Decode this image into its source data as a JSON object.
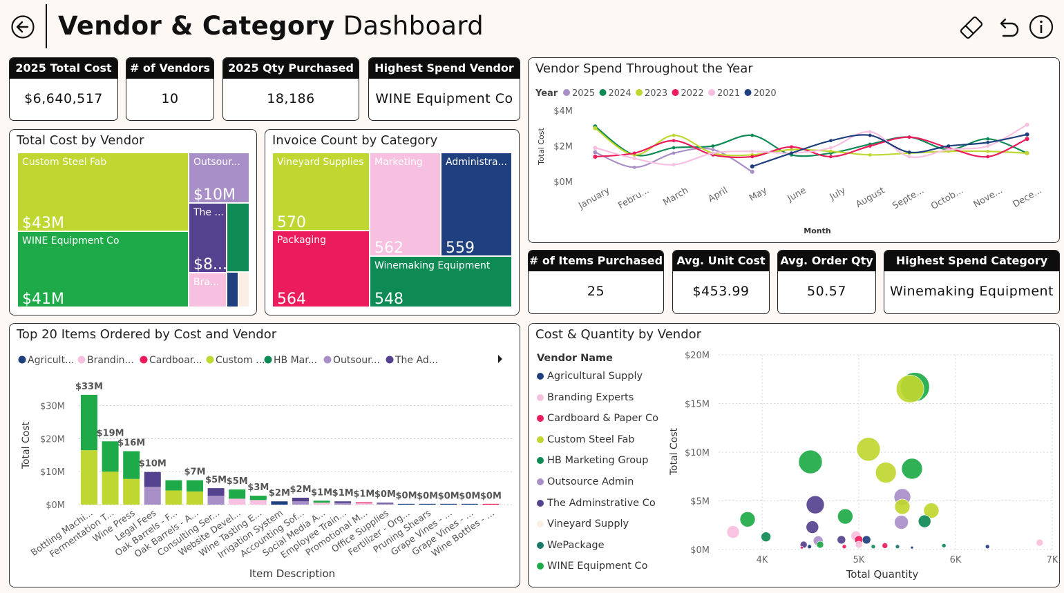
{
  "header": {
    "title_bold": "Vendor & Category",
    "title_rest": "Dashboard"
  },
  "kpis_top": [
    {
      "label": "2025 Total Cost",
      "value": "$6,640,517"
    },
    {
      "label": "# of Vendors",
      "value": "10"
    },
    {
      "label": "2025 Qty Purchased",
      "value": "18,186"
    },
    {
      "label": "Highest Spend Vendor",
      "value": "WINE Equipment Co"
    }
  ],
  "kpis_mid": [
    {
      "label": "# of Items Purchased",
      "value": "25"
    },
    {
      "label": "Avg. Unit Cost",
      "value": "$453.99"
    },
    {
      "label": "Avg. Order Qty",
      "value": "50.57"
    },
    {
      "label": "Highest Spend Category",
      "value": "Winemaking Equipment"
    }
  ],
  "vendor_tree": {
    "title": "Total Cost by Vendor",
    "tiles": [
      {
        "name": "Custom Steel Fab",
        "value": "$43M",
        "color": "#bfd730"
      },
      {
        "name": "WINE Equipment Co",
        "value": "$41M",
        "color": "#1eaa48"
      },
      {
        "name": "Outsour...",
        "value": "$10M",
        "color": "#a98fc8"
      },
      {
        "name": "The ...",
        "value": "$8...",
        "color": "#55428e"
      },
      {
        "name": "Bra...",
        "value": "",
        "color": "#f7bfe0"
      }
    ]
  },
  "category_tree": {
    "title": "Invoice Count by Category",
    "tiles": [
      {
        "name": "Vineyard Supplies",
        "value": "570",
        "color": "#bfd730"
      },
      {
        "name": "Packaging",
        "value": "564",
        "color": "#ec1b5b"
      },
      {
        "name": "Marketing",
        "value": "562",
        "color": "#f7bfe0"
      },
      {
        "name": "Administra...",
        "value": "559",
        "color": "#1f3f7e"
      },
      {
        "name": "Winemaking Equipment",
        "value": "548",
        "color": "#0e8a55"
      }
    ]
  },
  "kpi_colors": {
    "header_bg": "#0d0d0d"
  },
  "chart_data": [
    {
      "type": "line",
      "title": "Vendor Spend Throughout the Year",
      "xlabel": "Month",
      "ylabel": "Total Cost",
      "legend_title": "Year",
      "legend_position": "top-left",
      "categories": [
        "January",
        "Febru...",
        "March",
        "April",
        "May",
        "June",
        "July",
        "August",
        "Septe...",
        "Octob...",
        "Nove...",
        "Dece..."
      ],
      "yticks": [
        "$0M",
        "$2M",
        "$4M"
      ],
      "ylim": [
        0,
        4
      ],
      "series": [
        {
          "name": "2025",
          "color": "#a98fc8",
          "values": [
            1.65,
            0.8,
            1.6,
            1.8,
            0.55,
            null,
            null,
            null,
            null,
            null,
            null,
            null
          ]
        },
        {
          "name": "2024",
          "color": "#0e8a55",
          "values": [
            3.1,
            1.5,
            1.9,
            2.0,
            2.6,
            1.5,
            1.6,
            2.1,
            2.5,
            1.8,
            2.4,
            1.6
          ]
        },
        {
          "name": "2023",
          "color": "#bfd730",
          "values": [
            3.0,
            1.5,
            2.6,
            1.6,
            1.5,
            1.8,
            1.7,
            1.5,
            1.6,
            1.7,
            1.7,
            1.6
          ]
        },
        {
          "name": "2022",
          "color": "#ec1b5b",
          "values": [
            1.4,
            1.6,
            2.3,
            1.5,
            1.4,
            1.95,
            1.4,
            2.0,
            2.5,
            1.9,
            1.4,
            2.4
          ]
        },
        {
          "name": "2021",
          "color": "#f7bfe0",
          "values": [
            1.9,
            1.3,
            0.95,
            1.6,
            1.7,
            1.6,
            1.9,
            2.8,
            1.4,
            1.8,
            2.0,
            3.2
          ]
        },
        {
          "name": "2020",
          "color": "#1f3f7e",
          "values": [
            null,
            null,
            null,
            null,
            0.85,
            1.6,
            2.3,
            2.6,
            1.65,
            2.0,
            2.2,
            2.65
          ]
        }
      ]
    },
    {
      "type": "bar",
      "title": "Top 20 Items Ordered by Cost and Vendor",
      "xlabel": "Item Description",
      "ylabel": "Total Cost",
      "legend_position": "top",
      "legend": [
        {
          "name": "Agricult...",
          "color": "#1f3f7e"
        },
        {
          "name": "Brandin...",
          "color": "#f7bfe0"
        },
        {
          "name": "Cardboar...",
          "color": "#ec1b5b"
        },
        {
          "name": "Custom ...",
          "color": "#bfd730"
        },
        {
          "name": "HB Mar...",
          "color": "#0e8a55"
        },
        {
          "name": "Outsour...",
          "color": "#a98fc8"
        },
        {
          "name": "The Ad...",
          "color": "#55428e"
        }
      ],
      "yticks": [
        "$0M",
        "$10M",
        "$20M",
        "$30M"
      ],
      "ylim": [
        0,
        36
      ],
      "categories": [
        "Bottling Machi...",
        "Fermentation T...",
        "Wine Press",
        "Legal Fees",
        "Oak Barrels - F...",
        "Oak Barrels - A...",
        "Consulting Ser...",
        "Website Devel...",
        "Wine Tasting E...",
        "Irrigation System",
        "Accounting Sof...",
        "Social Media A...",
        "Employee Train...",
        "Promotional M...",
        "Office Supplies",
        "Fertilizer - Org...",
        "Pruning Shears",
        "Grape Vines - ...",
        "Grape Vines - ...",
        "Wine Bottles - ..."
      ],
      "totals_labels": [
        "$33M",
        "$19M",
        "$16M",
        "$10M",
        "",
        "$7M",
        "$5M",
        "$5M",
        "$3M",
        "$2M",
        "$2M",
        "$1M",
        "$1M",
        "$1M",
        "$0M",
        "$0M",
        "$0M",
        "$0M",
        "$0M",
        "$0M"
      ],
      "stacks": [
        [
          {
            "c": "#bfd730",
            "v": 16.5
          },
          {
            "c": "#1eaa48",
            "v": 16.8
          }
        ],
        [
          {
            "c": "#bfd730",
            "v": 10.0
          },
          {
            "c": "#1eaa48",
            "v": 9.2
          }
        ],
        [
          {
            "c": "#bfd730",
            "v": 7.8
          },
          {
            "c": "#1eaa48",
            "v": 8.4
          }
        ],
        [
          {
            "c": "#a98fc8",
            "v": 5.4
          },
          {
            "c": "#55428e",
            "v": 4.5
          }
        ],
        [
          {
            "c": "#bfd730",
            "v": 4.3
          },
          {
            "c": "#1eaa48",
            "v": 3.1
          }
        ],
        [
          {
            "c": "#bfd730",
            "v": 4.0
          },
          {
            "c": "#1eaa48",
            "v": 3.4
          }
        ],
        [
          {
            "c": "#a98fc8",
            "v": 2.7
          },
          {
            "c": "#55428e",
            "v": 2.3
          }
        ],
        [
          {
            "c": "#f7bfe0",
            "v": 1.8
          },
          {
            "c": "#1eaa48",
            "v": 2.8
          }
        ],
        [
          {
            "c": "#f7bfe0",
            "v": 1.4
          },
          {
            "c": "#1eaa48",
            "v": 1.3
          }
        ],
        [
          {
            "c": "#1f3f7e",
            "v": 1.0
          }
        ],
        [
          {
            "c": "#a98fc8",
            "v": 1.0
          },
          {
            "c": "#55428e",
            "v": 1.1
          }
        ],
        [
          {
            "c": "#f7bfe0",
            "v": 0.6
          },
          {
            "c": "#1eaa48",
            "v": 0.6
          }
        ],
        [
          {
            "c": "#a98fc8",
            "v": 0.5
          },
          {
            "c": "#55428e",
            "v": 0.5
          }
        ],
        [
          {
            "c": "#f7bfe0",
            "v": 0.4
          },
          {
            "c": "#ec1b5b",
            "v": 0.3
          }
        ],
        [
          {
            "c": "#a98fc8",
            "v": 0.3
          },
          {
            "c": "#55428e",
            "v": 0.3
          }
        ],
        [
          {
            "c": "#1f3f7e",
            "v": 0.2
          }
        ],
        [
          {
            "c": "#1f3f7e",
            "v": 0.15
          }
        ],
        [
          {
            "c": "#1f3f7e",
            "v": 0.1
          }
        ],
        [
          {
            "c": "#1f3f7e",
            "v": 0.1
          }
        ],
        [
          {
            "c": "#ec1b5b",
            "v": 0.08
          }
        ]
      ]
    },
    {
      "type": "scatter",
      "title": "Cost & Quantity by Vendor",
      "xlabel": "Total Quantity",
      "ylabel": "Total Cost",
      "legend_title": "Vendor Name",
      "legend_position": "left",
      "xticks": [
        "4K",
        "5K",
        "6K",
        "7K"
      ],
      "yticks": [
        "$0M",
        "$5M",
        "$10M",
        "$15M",
        "$20M"
      ],
      "xlim": [
        3.55,
        7.0
      ],
      "ylim": [
        0,
        20
      ],
      "vendors": [
        {
          "name": "Agricultural Supply",
          "color": "#1f3f7e"
        },
        {
          "name": "Branding Experts",
          "color": "#f7bfe0"
        },
        {
          "name": "Cardboard & Paper Co",
          "color": "#ec1b5b"
        },
        {
          "name": "Custom Steel Fab",
          "color": "#bfd730"
        },
        {
          "name": "HB Marketing Group",
          "color": "#0e8a55"
        },
        {
          "name": "Outsource Admin",
          "color": "#a98fc8"
        },
        {
          "name": "The Adminstrative Co",
          "color": "#55428e"
        },
        {
          "name": "Vineyard Supply",
          "color": "#fbeee4"
        },
        {
          "name": "WePackage",
          "color": "#1a7a6a"
        },
        {
          "name": "WINE Equipment Co",
          "color": "#1eaa48"
        }
      ],
      "points": [
        {
          "x": 5.58,
          "y": 16.7,
          "s": 21,
          "c": "#1eaa48"
        },
        {
          "x": 5.53,
          "y": 16.5,
          "s": 20,
          "c": "#bfd730"
        },
        {
          "x": 5.1,
          "y": 10.3,
          "s": 17,
          "c": "#bfd730"
        },
        {
          "x": 4.5,
          "y": 9.0,
          "s": 17,
          "c": "#1eaa48"
        },
        {
          "x": 5.28,
          "y": 7.9,
          "s": 15,
          "c": "#bfd730"
        },
        {
          "x": 5.55,
          "y": 8.3,
          "s": 15,
          "c": "#1eaa48"
        },
        {
          "x": 4.55,
          "y": 4.6,
          "s": 13,
          "c": "#55428e"
        },
        {
          "x": 5.45,
          "y": 5.4,
          "s": 12,
          "c": "#a98fc8"
        },
        {
          "x": 5.45,
          "y": 4.4,
          "s": 11,
          "c": "#bfd730"
        },
        {
          "x": 5.75,
          "y": 4.0,
          "s": 11,
          "c": "#bfd730"
        },
        {
          "x": 3.85,
          "y": 3.1,
          "s": 11,
          "c": "#1eaa48"
        },
        {
          "x": 4.86,
          "y": 3.4,
          "s": 11,
          "c": "#1eaa48"
        },
        {
          "x": 5.44,
          "y": 2.8,
          "s": 10,
          "c": "#a98fc8"
        },
        {
          "x": 5.68,
          "y": 2.9,
          "s": 9,
          "c": "#0e8a55"
        },
        {
          "x": 4.52,
          "y": 2.3,
          "s": 9,
          "c": "#55428e"
        },
        {
          "x": 3.7,
          "y": 1.8,
          "s": 9,
          "c": "#f7bfe0"
        },
        {
          "x": 4.04,
          "y": 1.3,
          "s": 7,
          "c": "#0e8a55"
        },
        {
          "x": 4.97,
          "y": 1.4,
          "s": 7,
          "c": "#f7bfe0"
        },
        {
          "x": 4.58,
          "y": 0.9,
          "s": 7,
          "c": "#a98fc8"
        },
        {
          "x": 4.82,
          "y": 1.0,
          "s": 6,
          "c": "#55428e"
        },
        {
          "x": 5.0,
          "y": 1.0,
          "s": 6,
          "c": "#ec1b5b"
        },
        {
          "x": 5.08,
          "y": 1.0,
          "s": 6,
          "c": "#1f3f7e"
        },
        {
          "x": 4.43,
          "y": 0.5,
          "s": 5,
          "c": "#55428e"
        },
        {
          "x": 4.6,
          "y": 0.5,
          "s": 5,
          "c": "#1eaa48"
        },
        {
          "x": 5.0,
          "y": 0.5,
          "s": 5,
          "c": "#f7bfe0"
        },
        {
          "x": 5.27,
          "y": 0.4,
          "s": 4,
          "c": "#ec1b5b"
        },
        {
          "x": 6.87,
          "y": 0.7,
          "s": 5,
          "c": "#f7bfe0"
        },
        {
          "x": 4.49,
          "y": 0.3,
          "s": 3,
          "c": "#1f3f7e"
        },
        {
          "x": 4.85,
          "y": 0.3,
          "s": 3,
          "c": "#ec1b5b"
        },
        {
          "x": 5.15,
          "y": 0.3,
          "s": 3,
          "c": "#0e8a55"
        },
        {
          "x": 5.4,
          "y": 0.3,
          "s": 3,
          "c": "#1a7a6a"
        },
        {
          "x": 5.88,
          "y": 0.4,
          "s": 3,
          "c": "#0e8a55"
        },
        {
          "x": 6.33,
          "y": 0.3,
          "s": 3,
          "c": "#1f3f7e"
        },
        {
          "x": 4.41,
          "y": 0.2,
          "s": 2,
          "c": "#ec1b5b"
        },
        {
          "x": 5.55,
          "y": 0.2,
          "s": 2,
          "c": "#1f3f7e"
        }
      ]
    }
  ]
}
